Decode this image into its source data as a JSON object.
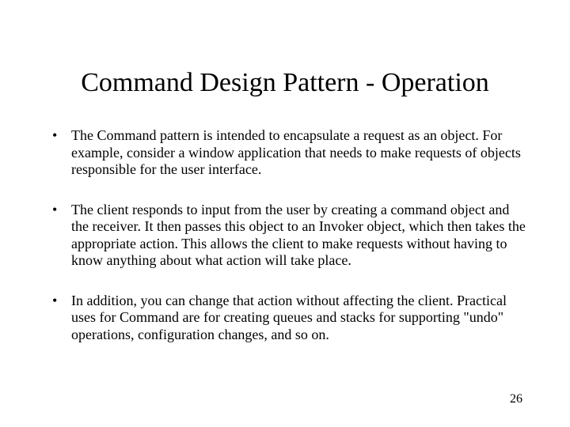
{
  "title": "Command Design Pattern - Operation",
  "bullets": [
    "The Command pattern is intended to encapsulate a request as an object. For example, consider a window application that needs to make requests of objects responsible for the user interface.",
    "The client responds to input from the user by creating a command object and the receiver. It then passes this object to an Invoker object, which then takes the appropriate action. This allows the client to make requests without having to know anything about what action will take place.",
    "In addition, you can change that action without affecting the client. Practical uses for Command are for creating queues and stacks for supporting \"undo\" operations, configuration changes, and so on."
  ],
  "page_number": "26"
}
